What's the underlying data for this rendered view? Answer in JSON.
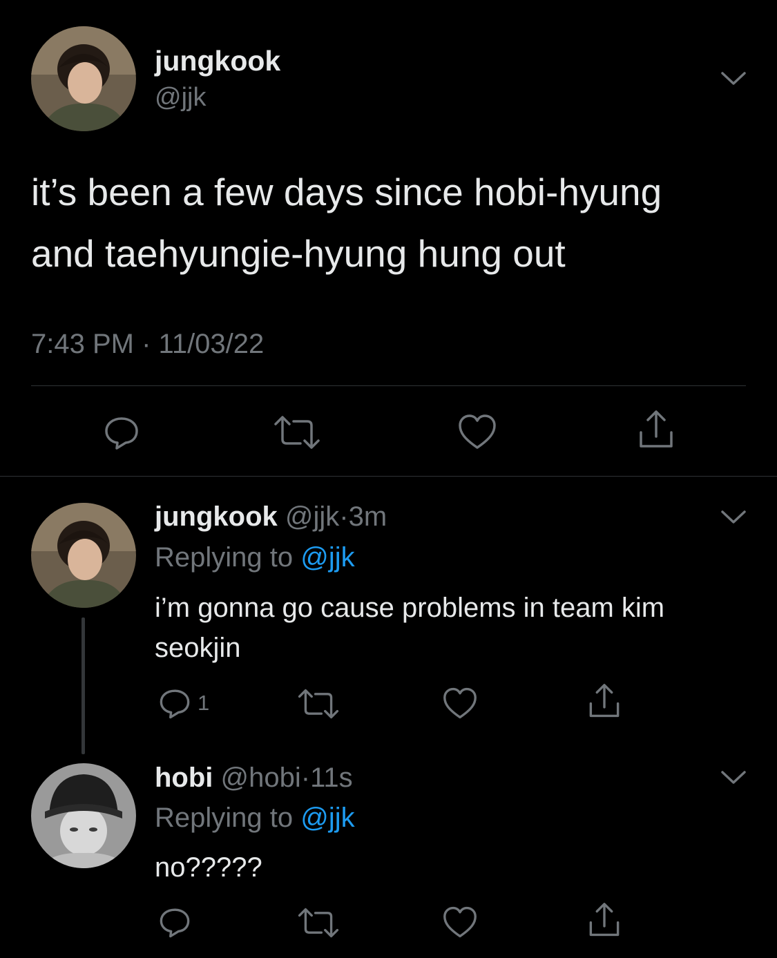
{
  "main_tweet": {
    "display_name": "jungkook",
    "handle": "@jjk",
    "text_line1": "it’s been a few days since hobi-hyung",
    "text_line2": "and taehyungie-hyung hung out",
    "time": "7:43 PM",
    "separator": "·",
    "date": "11/03/22"
  },
  "reply1": {
    "display_name": "jungkook",
    "handle": "@jjk",
    "dot": "·",
    "age": "3m",
    "replying_label": "Replying to",
    "replying_handle": "@jjk",
    "text_line1": "i’m gonna go cause problems in team kim",
    "text_line2": "seokjin",
    "reply_count": "1"
  },
  "reply2": {
    "display_name": "hobi",
    "handle": "@hobi",
    "dot": "·",
    "age": "11s",
    "replying_label": "Replying to",
    "replying_handle": "@jjk",
    "text": "no?????"
  },
  "colors": {
    "background": "#000000",
    "text": "#e7e9ea",
    "muted": "#71767b",
    "link": "#1d9bf0",
    "divider": "#2f3336"
  },
  "icons": [
    "chevron-down-icon",
    "reply-icon",
    "retweet-icon",
    "like-icon",
    "share-icon"
  ]
}
